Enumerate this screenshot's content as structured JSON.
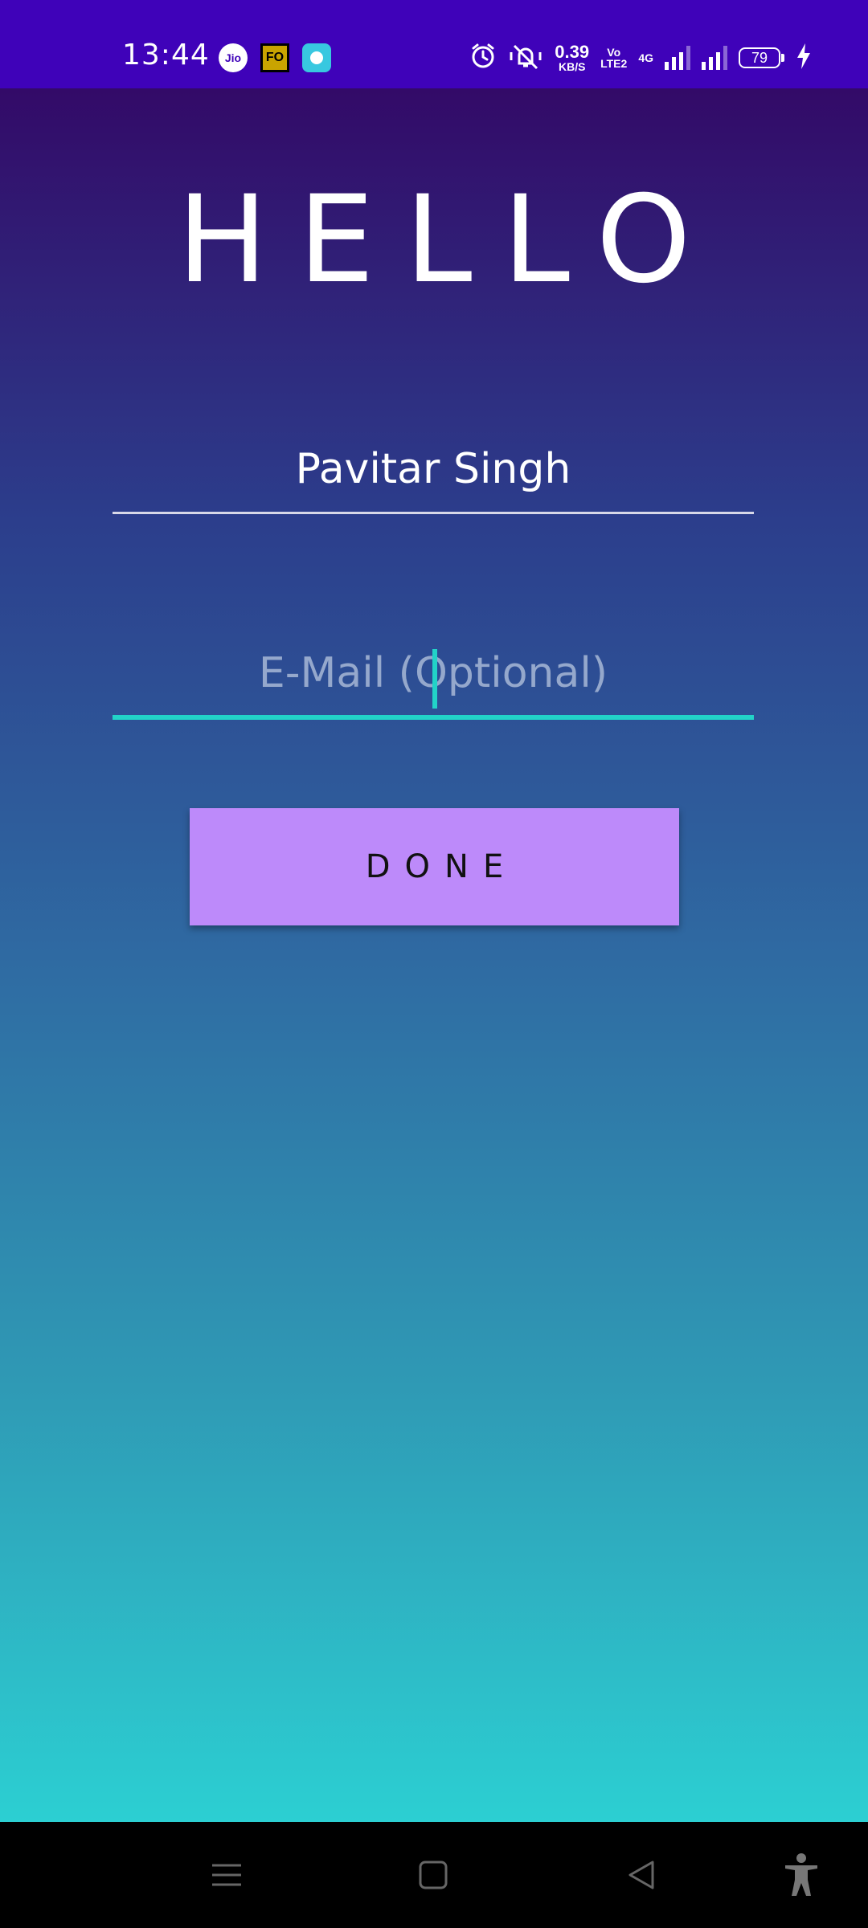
{
  "status_bar": {
    "time": "13:44",
    "jio_label": "Jio",
    "fo_label": "FO",
    "net_speed": "0.39",
    "net_speed_unit": "KB/S",
    "volte_top": "Vo",
    "volte_bottom": "LTE2",
    "network_type": "4G",
    "battery_level": "79"
  },
  "main": {
    "greeting": "HELLO",
    "name_value": "Pavitar Singh",
    "email_placeholder": "E-Mail (Optional)",
    "done_label": "DONE"
  },
  "colors": {
    "status_bar_bg": "#3f02b9",
    "accent": "#22d3c8",
    "button_bg": "#bd8afa"
  }
}
